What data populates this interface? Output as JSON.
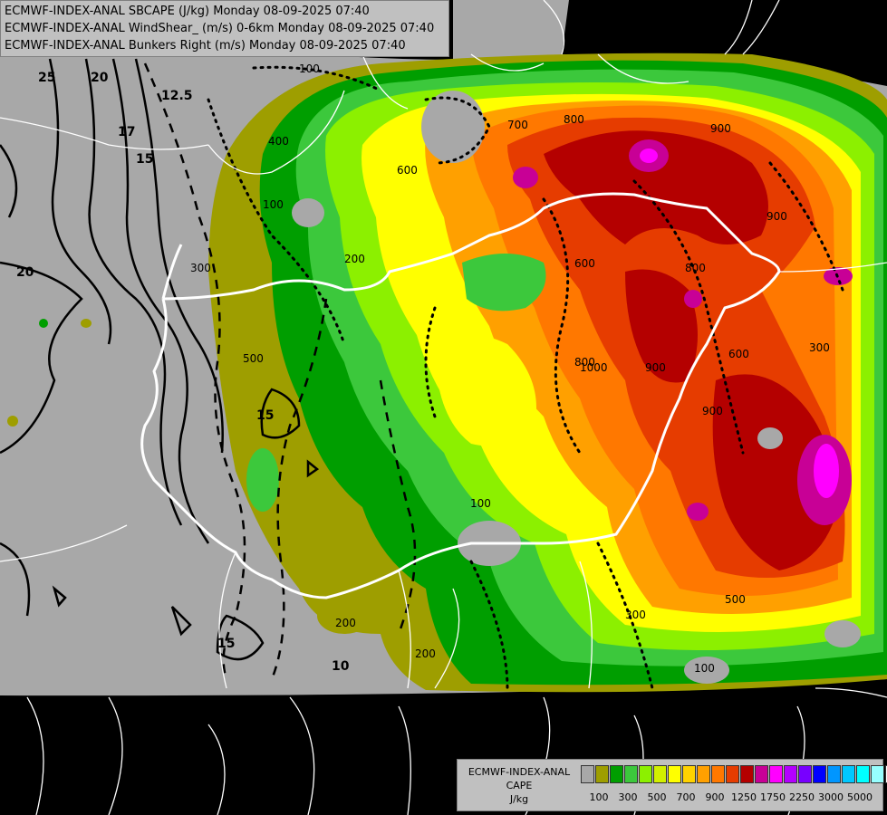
{
  "titles": [
    "ECMWF-INDEX-ANAL SBCAPE (J/kg) Monday 08-09-2025 07:40",
    "ECMWF-INDEX-ANAL WindShear_ (m/s) 0-6km Monday 08-09-2025 07:40",
    "ECMWF-INDEX-ANAL Bunkers Right (m/s) Monday 08-09-2025 07:40"
  ],
  "legend": {
    "title_lines": [
      "ECMWF-INDEX-ANAL",
      "CAPE",
      "J/kg"
    ],
    "colors": [
      "#a8a8a8",
      "#9e9e00",
      "#009e00",
      "#3cc83c",
      "#8cf000",
      "#d2f000",
      "#ffff00",
      "#ffd200",
      "#ffa000",
      "#ff7800",
      "#e63c00",
      "#b40000",
      "#c80096",
      "#ff00ff",
      "#b400ff",
      "#7800ff",
      "#0000ff",
      "#0096ff",
      "#00c8ff",
      "#00ffff",
      "#96ffff",
      "#ffffff"
    ],
    "tick_labels": [
      "100",
      "300",
      "500",
      "700",
      "900",
      "1250",
      "1750",
      "2250",
      "3000",
      "5000"
    ]
  },
  "shear_labels": [
    "25",
    "20",
    "17",
    "15",
    "12.5",
    "20",
    "15",
    "15",
    "10"
  ],
  "cape_labels": [
    "100",
    "400",
    "600",
    "700",
    "800",
    "900",
    "100",
    "300",
    "500",
    "200",
    "900",
    "600",
    "100",
    "200",
    "300",
    "800",
    "900",
    "900",
    "600",
    "1000",
    "800",
    "500",
    "300",
    "100",
    "200"
  ]
}
